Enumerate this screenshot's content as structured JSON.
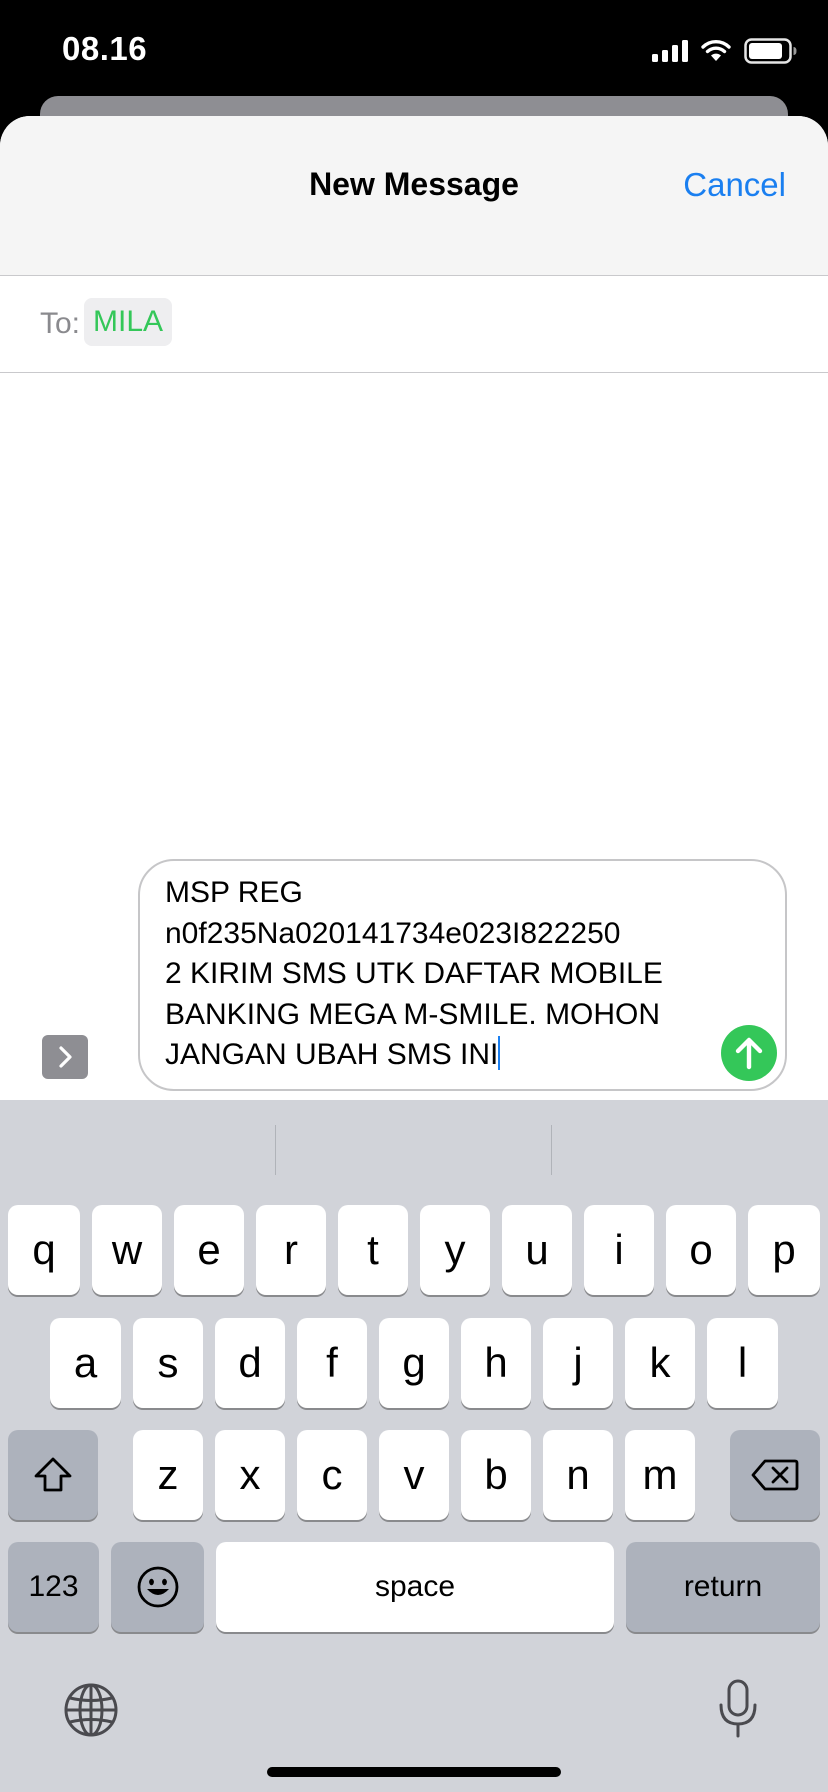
{
  "status": {
    "time": "08.16"
  },
  "nav": {
    "title": "New Message",
    "cancel": "Cancel"
  },
  "recipient": {
    "label": "To:",
    "name": "MILA"
  },
  "composer": {
    "text": "MSP REG\nn0f235Na020141734e023I822250\n2 KIRIM SMS UTK DAFTAR MOBILE\nBANKING MEGA M-SMILE. MOHON\nJANGAN UBAH SMS INI"
  },
  "keyboard": {
    "row1": [
      "q",
      "w",
      "e",
      "r",
      "t",
      "y",
      "u",
      "i",
      "o",
      "p"
    ],
    "row2": [
      "a",
      "s",
      "d",
      "f",
      "g",
      "h",
      "j",
      "k",
      "l"
    ],
    "row3": [
      "z",
      "x",
      "c",
      "v",
      "b",
      "n",
      "m"
    ],
    "numbers": "123",
    "space": "space",
    "return": "return"
  },
  "colors": {
    "accent": "#1a7ff0",
    "send": "#34c759",
    "recipient": "#34c759"
  }
}
